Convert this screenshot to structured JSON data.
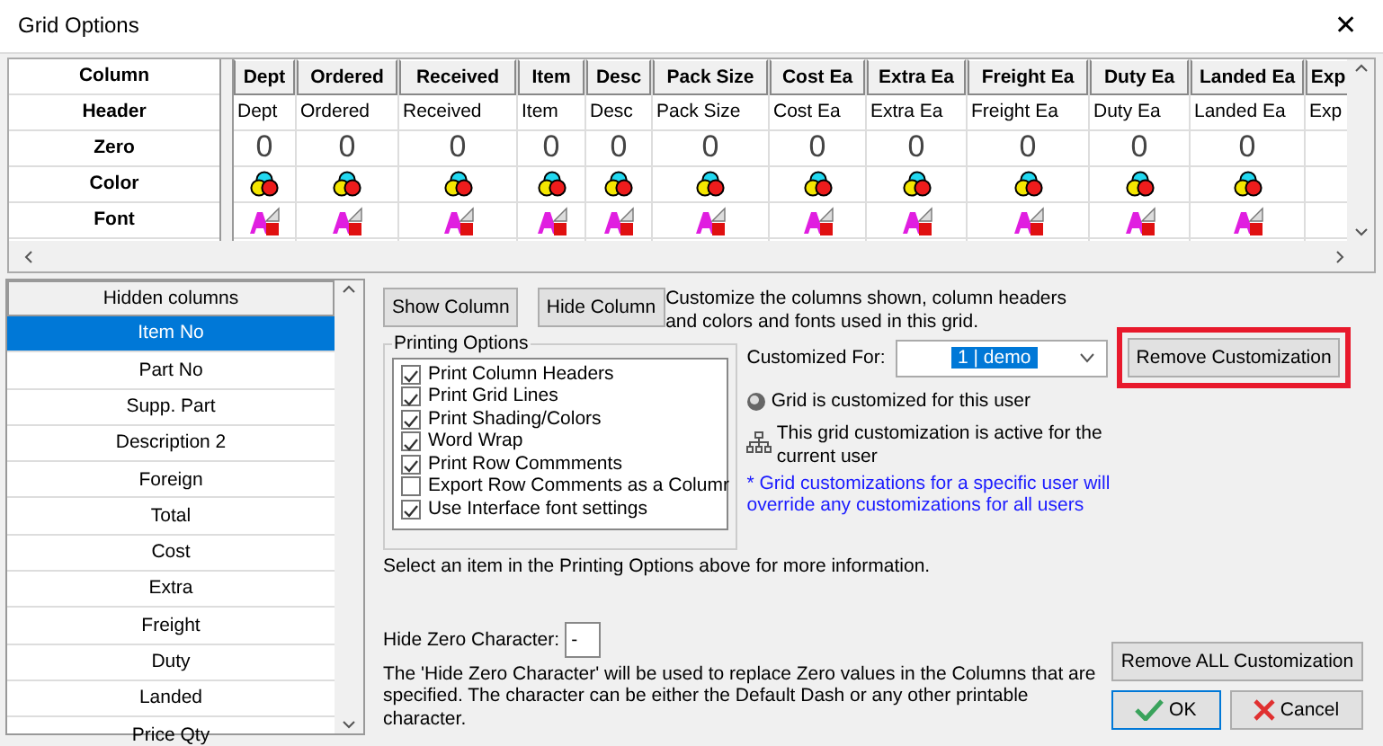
{
  "window": {
    "title": "Grid Options",
    "close": "✕"
  },
  "grid": {
    "row_labels": [
      "Column",
      "Header",
      "Zero",
      "Color",
      "Font"
    ],
    "columns": [
      {
        "name": "Dept",
        "header": "Dept",
        "zero": "0",
        "styled": true
      },
      {
        "name": "Ordered",
        "header": "Ordered",
        "zero": "0",
        "styled": true
      },
      {
        "name": "Received",
        "header": "Received",
        "zero": "0",
        "styled": true
      },
      {
        "name": "Item",
        "header": "Item",
        "zero": "0",
        "styled": true
      },
      {
        "name": "Desc",
        "header": "Desc",
        "zero": "0",
        "styled": true
      },
      {
        "name": "Pack Size",
        "header": "Pack Size",
        "zero": "0",
        "styled": true
      },
      {
        "name": "Cost Ea",
        "header": "Cost Ea",
        "zero": "0",
        "styled": true
      },
      {
        "name": "Extra Ea",
        "header": "Extra Ea",
        "zero": "0",
        "styled": true
      },
      {
        "name": "Freight Ea",
        "header": "Freight Ea",
        "zero": "0",
        "styled": true
      },
      {
        "name": "Duty Ea",
        "header": "Duty Ea",
        "zero": "0",
        "styled": true
      },
      {
        "name": "Landed Ea",
        "header": "Landed Ea",
        "zero": "0",
        "styled": true
      },
      {
        "name": "Exp",
        "header": "Exp",
        "styled": false
      }
    ]
  },
  "hidden_columns": {
    "heading": "Hidden columns",
    "items": [
      {
        "label": "Item No",
        "selected": true
      },
      {
        "label": "Part No",
        "selected": false
      },
      {
        "label": "Supp. Part",
        "selected": false
      },
      {
        "label": "Description 2",
        "selected": false
      },
      {
        "label": "Foreign",
        "selected": false
      },
      {
        "label": "Total",
        "selected": false
      },
      {
        "label": "Cost",
        "selected": false
      },
      {
        "label": "Extra",
        "selected": false
      },
      {
        "label": "Freight",
        "selected": false
      },
      {
        "label": "Duty",
        "selected": false
      },
      {
        "label": "Landed",
        "selected": false
      },
      {
        "label": "Price Qty",
        "selected": false
      }
    ]
  },
  "show_column_button": "Show Column",
  "hide_column_button": "Hide Column",
  "description": "Customize the columns shown, column headers and colors and fonts used in this grid.",
  "printing_options": {
    "title": "Printing Options",
    "items": [
      {
        "label": "Print Column Headers",
        "checked": true
      },
      {
        "label": "Print Grid Lines",
        "checked": true
      },
      {
        "label": "Print Shading/Colors",
        "checked": true
      },
      {
        "label": "Word Wrap",
        "checked": true
      },
      {
        "label": "Print Row Commments",
        "checked": true
      },
      {
        "label": "Export Row Comments as a Columr",
        "checked": false
      },
      {
        "label": "Use Interface font settings",
        "checked": true
      }
    ]
  },
  "customized_for": {
    "label": "Customized For:",
    "value": "1 | demo"
  },
  "remove_customization_button": {
    "label": "Remove Customization",
    "highlighted": true
  },
  "status_customized": "Grid is customized for this user",
  "status_active": "This grid customization is active for the current user",
  "note": "* Grid customizations for a specific user will override any customizations for all users",
  "hint": "Select an item in the Printing Options above for more information.",
  "hide_zero": {
    "label": "Hide Zero Character:",
    "value": "-"
  },
  "hide_zero_note": "The 'Hide Zero Character' will be used to replace Zero values in the Columns that are specified. The character can be either the Default Dash or any other printable character.",
  "remove_all_button": "Remove ALL Customization",
  "ok_button": "OK",
  "cancel_button": "Cancel"
}
